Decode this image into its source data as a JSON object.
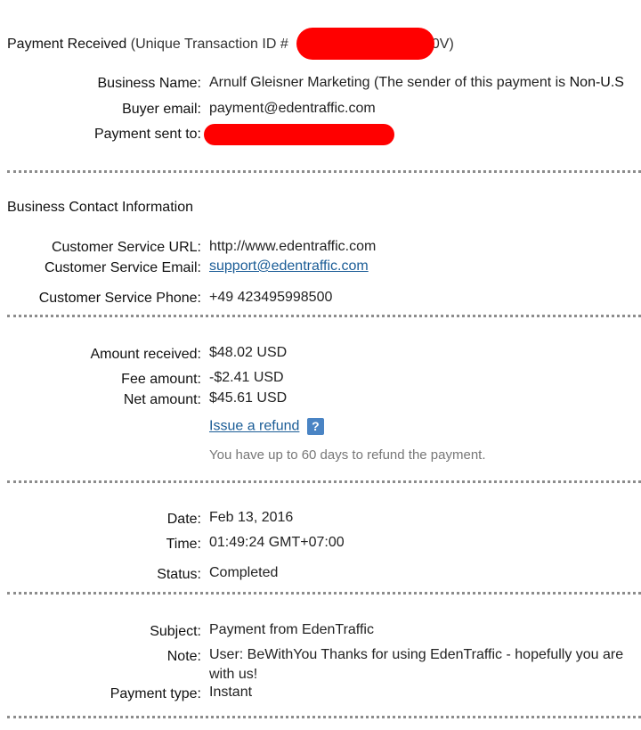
{
  "header": {
    "title": "Payment Received",
    "transaction_prefix": "(Unique Transaction ID #",
    "transaction_suffix": "40V)"
  },
  "business": {
    "name_label": "Business Name:",
    "name_value": "Arnulf Gleisner Marketing (The sender of this payment is",
    "name_value_bold": "Non-U.S",
    "buyer_email_label": "Buyer email:",
    "buyer_email_value": "payment@edentraffic.com",
    "sent_to_label": "Payment sent to:"
  },
  "contact": {
    "heading": "Business Contact Information",
    "url_label": "Customer Service URL:",
    "url_value": "http://www.edentraffic.com",
    "email_label": "Customer Service Email:",
    "email_value": "support@edentraffic.com",
    "phone_label": "Customer Service Phone:",
    "phone_value": "+49 423495998500"
  },
  "amounts": {
    "received_label": "Amount received:",
    "received_value": "$48.02 USD",
    "fee_label": "Fee amount:",
    "fee_value": "-$2.41 USD",
    "net_label": "Net amount:",
    "net_value": "$45.61 USD",
    "refund_link": "Issue a refund",
    "help_glyph": "?",
    "refund_note": "You have up to 60 days to refund the payment."
  },
  "datetime": {
    "date_label": "Date:",
    "date_value": "Feb 13, 2016",
    "time_label": "Time:",
    "time_value": "01:49:24 GMT+07:00",
    "status_label": "Status:",
    "status_value": "Completed"
  },
  "details": {
    "subject_label": "Subject:",
    "subject_value": "Payment from EdenTraffic",
    "note_label": "Note:",
    "note_line1": "User: BeWithYou Thanks for using EdenTraffic - hopefully you are",
    "note_line2": "with us!",
    "type_label": "Payment type:",
    "type_value": "Instant"
  },
  "colors": {
    "link": "#1a5c96",
    "redaction": "#ff0000",
    "divider": "#8c8c8c",
    "help_icon": "#4a84c4"
  }
}
